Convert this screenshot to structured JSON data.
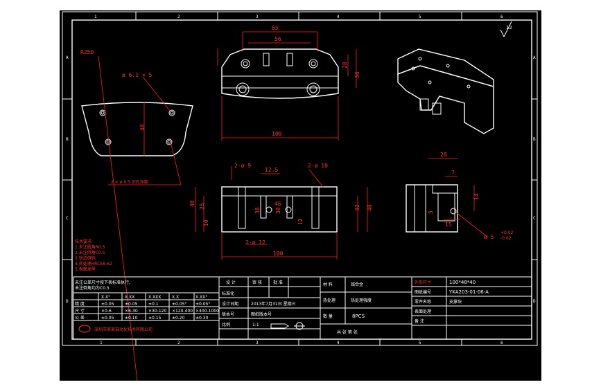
{
  "border": {
    "top_zones": [
      "1",
      "2",
      "3",
      "4",
      "5",
      "6"
    ],
    "bottom_zones": [
      "1",
      "2",
      "3",
      "4",
      "5",
      "6"
    ],
    "side_zones": [
      "A",
      "B",
      "C",
      "D"
    ]
  },
  "roughness": "12",
  "dims": {
    "top_w65": "65",
    "top_w56": "56",
    "top_15": "15",
    "top_28": "28",
    "top_36": "36",
    "top_100": "100",
    "plate_r250": "R250",
    "plate_hole": "ø 6.1 × 5",
    "plate_48": "48",
    "plate_chamfer": "2 × ø  6.5 沉孔深度",
    "front_2d9": "2-ø 9",
    "front_125": "12.5",
    "front_2d10": "2-ø 10",
    "front_40L": "40",
    "front_25": "25",
    "front_10": "10",
    "front_38": "38",
    "front_30": "30",
    "front_12": "12",
    "front_46": "46",
    "front_40R": "40",
    "front_32": "32",
    "front_2d12": "2-ø 12",
    "front_100": "100",
    "side_28": "28",
    "side_7": "7",
    "side_14": "14",
    "side_5": "5",
    "side_15": "15",
    "side_phi5": "ø 5",
    "side_tol_plus": "+0.02",
    "side_tol_minus": "-0.02"
  },
  "notes": {
    "line1": "技术要求",
    "line2": "1.未注圆角R0.5",
    "line3": "2.未注倒角C0.5",
    "line4": "3.锐边倒钝",
    "line5": "4.热处理HRC58-62",
    "line6": "5.表面发黑"
  },
  "tolerance_table": {
    "header": "未注公差尺寸按下表标准执行,",
    "header2": "未注倒角均为C0.5",
    "cols": [
      "X.X°",
      "X.XX",
      "X.XXX",
      "X.X",
      "X.XX°",
      "X.XX°"
    ],
    "rows": [
      [
        "精 度",
        "±0.05",
        "±0.05",
        "±0.1",
        "±0.05°",
        "±0.05°"
      ],
      [
        "尺 寸",
        "×0-6",
        "×6-30",
        "×30-120",
        "×120-400",
        "×400-1000"
      ],
      [
        "公 差",
        "±0.05",
        "±0.10",
        "±0.15",
        "±0.20",
        "±0.30"
      ]
    ],
    "company": "深圳市某某自动化技术有限公司"
  },
  "title_block": {
    "designer_hdr": "设 计",
    "check_hdr": "审 核",
    "approve_hdr": "批 准",
    "std_label": "标准化",
    "date_label": "设计日期",
    "date_value": "2013年7月31日 星期三",
    "ver_label": "版本号",
    "ver_value": "图纸版本号",
    "scale_label": "比例",
    "scale_value": "1:1",
    "material_label": "材 料",
    "material_value": "铬合金",
    "treat_label": "热处理",
    "treat_value": "热处理强度",
    "qty_label": "数 量",
    "qty_value": "8PCS",
    "sheet_label": "共 张  第 张",
    "size_label": "外形尺寸",
    "size_value": "100*48*40",
    "drawing_no_label": "图纸编号",
    "drawing_no_value": "YKA203-01-06-A",
    "part_name_label": "零件名称",
    "part_name_value": "支撑块",
    "surface_label": "表面处理",
    "note_label": "备 注"
  }
}
